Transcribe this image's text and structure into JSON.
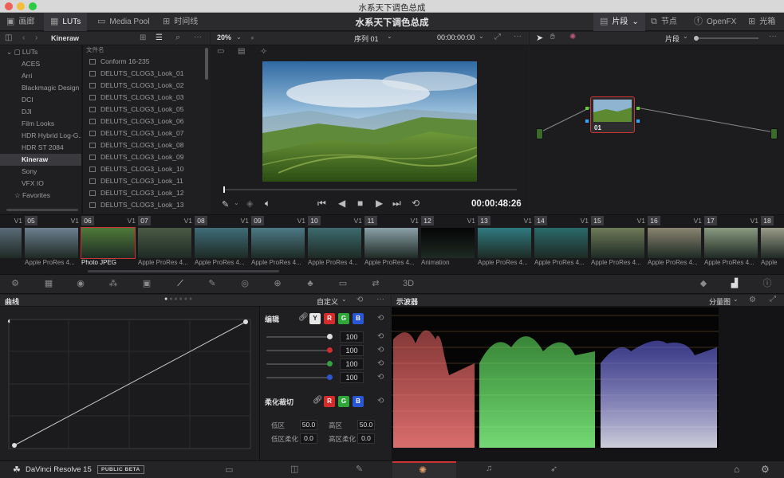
{
  "window_title": "水系天下调色总成",
  "project_title": "水系天下调色总成",
  "toolbar_left": [
    {
      "label": "画廊",
      "icon": "gallery-icon"
    },
    {
      "label": "LUTs",
      "icon": "luts-icon"
    },
    {
      "label": "Media Pool",
      "icon": "media-pool-icon"
    },
    {
      "label": "时间线",
      "icon": "timeline-icon"
    }
  ],
  "toolbar_right": [
    {
      "label": "片段",
      "icon": "clip-icon"
    },
    {
      "label": "节点",
      "icon": "nodes-icon"
    },
    {
      "label": "OpenFX",
      "icon": "fx-icon"
    },
    {
      "label": "光箱",
      "icon": "lightbox-icon"
    }
  ],
  "lut_browser": {
    "location": "Kineraw",
    "root": "LUTs",
    "categories": [
      "ACES",
      "Arri",
      "Blackmagic Design",
      "DCI",
      "DJI",
      "Film Looks",
      "HDR Hybrid Log-G...",
      "HDR ST 2084",
      "Kineraw",
      "Sony",
      "VFX IO"
    ],
    "selected": "Kineraw",
    "favorites": "Favorites",
    "file_header": "文件名",
    "files": [
      "Conform 16-235",
      "DELUTS_CLOG3_Look_01",
      "DELUTS_CLOG3_Look_02",
      "DELUTS_CLOG3_Look_03",
      "DELUTS_CLOG3_Look_05",
      "DELUTS_CLOG3_Look_06",
      "DELUTS_CLOG3_Look_07",
      "DELUTS_CLOG3_Look_08",
      "DELUTS_CLOG3_Look_09",
      "DELUTS_CLOG3_Look_10",
      "DELUTS_CLOG3_Look_11",
      "DELUTS_CLOG3_Look_12",
      "DELUTS_CLOG3_Look_13"
    ]
  },
  "viewer": {
    "zoom": "20%",
    "sequence": "序列 01",
    "timecode_top": "00:00:00:00",
    "timecode": "00:00:48:26",
    "progress": 0.0
  },
  "node_panel": {
    "mode": "片段",
    "node_label": "01"
  },
  "clips": [
    {
      "num": "",
      "track": "V1",
      "name": "es 4...",
      "color": "#5a6a78"
    },
    {
      "num": "05",
      "track": "V1",
      "name": "Apple ProRes 4...",
      "color": "#6d7f91"
    },
    {
      "num": "06",
      "track": "V1",
      "name": "Photo JPEG",
      "color": "#4f7a3a",
      "selected": true
    },
    {
      "num": "07",
      "track": "V1",
      "name": "Apple ProRes 4...",
      "color": "#4b5a44"
    },
    {
      "num": "08",
      "track": "V1",
      "name": "Apple ProRes 4...",
      "color": "#3f6c78"
    },
    {
      "num": "09",
      "track": "V1",
      "name": "Apple ProRes 4...",
      "color": "#4c7a86"
    },
    {
      "num": "10",
      "track": "V1",
      "name": "Apple ProRes 4...",
      "color": "#3d6a6e"
    },
    {
      "num": "11",
      "track": "V1",
      "name": "Apple ProRes 4...",
      "color": "#8aa0a8"
    },
    {
      "num": "12",
      "track": "V1",
      "name": "Animation",
      "color": "#050505"
    },
    {
      "num": "13",
      "track": "V1",
      "name": "Apple ProRes 4...",
      "color": "#2f7a80"
    },
    {
      "num": "14",
      "track": "V1",
      "name": "Apple ProRes 4...",
      "color": "#2a6a6a"
    },
    {
      "num": "15",
      "track": "V1",
      "name": "Apple ProRes 4...",
      "color": "#6e7a58"
    },
    {
      "num": "16",
      "track": "V1",
      "name": "Apple ProRes 4...",
      "color": "#8a8470"
    },
    {
      "num": "17",
      "track": "V1",
      "name": "Apple ProRes 4...",
      "color": "#8a9a80"
    },
    {
      "num": "18",
      "track": "",
      "name": "Apple",
      "color": "#9a9a88"
    }
  ],
  "curves": {
    "title": "曲线",
    "mode": "自定义",
    "edit_label": "编辑",
    "channels": [
      "Y",
      "R",
      "G",
      "B"
    ],
    "values": [
      "100",
      "100",
      "100",
      "100"
    ],
    "soft_clip_label": "柔化裁切",
    "low_label": "低区",
    "low_value": "50.0",
    "high_label": "高区",
    "high_value": "50.0",
    "low_soft_label": "低区柔化",
    "low_soft_value": "0.0",
    "high_soft_label": "高区柔化",
    "high_soft_value": "0.0"
  },
  "scope": {
    "title": "示波器",
    "mode": "分量图"
  },
  "app": {
    "name": "DaVinci Resolve 15",
    "badge": "PUBLIC BETA"
  },
  "colors": {
    "red": "#d62b2b",
    "green": "#2fa53a",
    "blue": "#2a55d4",
    "selection": "#c33a3a"
  }
}
